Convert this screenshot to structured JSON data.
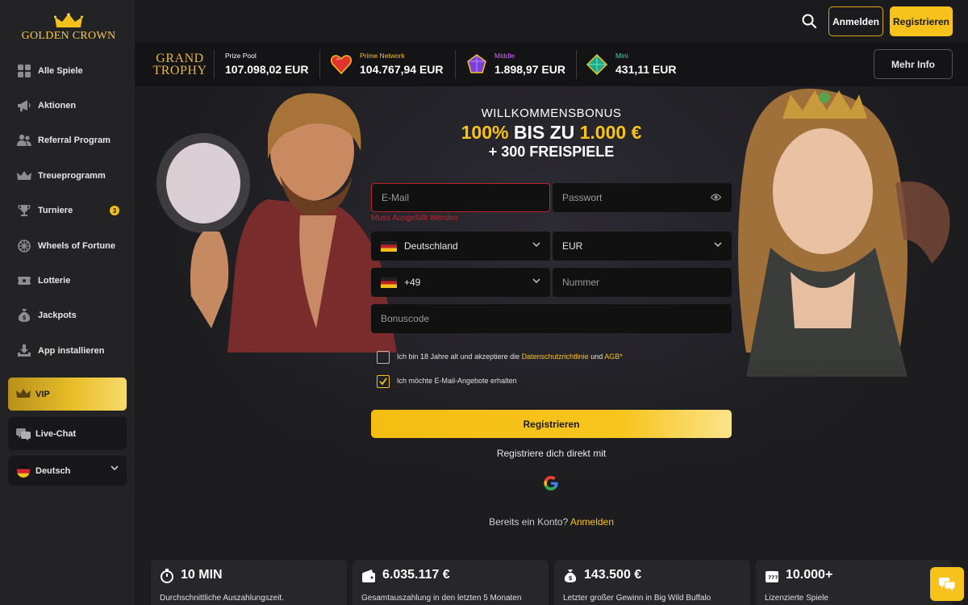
{
  "brand": {
    "name": "GOLDEN CROWN",
    "accent": "#f6c21b"
  },
  "sidebar": {
    "items": [
      {
        "label": "Alle Spiele",
        "icon": "grid-icon"
      },
      {
        "label": "Aktionen",
        "icon": "megaphone-icon"
      },
      {
        "label": "Referral Program",
        "icon": "users-icon"
      },
      {
        "label": "Treueprogramm",
        "icon": "crown-icon"
      },
      {
        "label": "Turniere",
        "icon": "trophy-icon",
        "badge": "3"
      },
      {
        "label": "Wheels of Fortune",
        "icon": "wheel-icon"
      },
      {
        "label": "Lotterie",
        "icon": "ticket-icon"
      },
      {
        "label": "Jackpots",
        "icon": "money-bag-icon"
      },
      {
        "label": "App installieren",
        "icon": "download-icon"
      }
    ],
    "vip_label": "VIP",
    "livechat_label": "Live-Chat",
    "language": "Deutsch"
  },
  "header": {
    "login_label": "Anmelden",
    "register_label": "Registrieren"
  },
  "jackpot": {
    "logo_line1": "GRAND",
    "logo_line2": "TROPHY",
    "tiers": [
      {
        "name": "Prize Pool",
        "value": "107.098,02 EUR",
        "color": "#ffffff"
      },
      {
        "name": "Prime Network",
        "value": "104.767,94 EUR",
        "color": "#f6c21b"
      },
      {
        "name": "Middle",
        "value": "1.898,97 EUR",
        "color": "#d06bf2"
      },
      {
        "name": "Mini",
        "value": "431,11 EUR",
        "color": "#42d6a3"
      }
    ],
    "more_info_label": "Mehr Info"
  },
  "bonus": {
    "title": "WILLKOMMENSBONUS",
    "percent": "100%",
    "upto": "BIS ZU",
    "amount": "1.000 €",
    "spins": "+ 300 FREISPIELE"
  },
  "form": {
    "email_placeholder": "E-Mail",
    "email_error": "Muss Ausgefüllt Werden",
    "password_placeholder": "Passwort",
    "country": "Deutschland",
    "currency": "EUR",
    "phone_code": "+49",
    "phone_placeholder": "Nummer",
    "bonus_placeholder": "Bonuscode",
    "terms_prefix": "Ich bin 18 Jahre alt und akzeptiere die",
    "terms_link": "Datenschutzrichtlinie",
    "terms_and": "und",
    "agb_link": "AGB",
    "terms_required": "*",
    "terms_checked": false,
    "email_offers_label": "Ich möchte E-Mail-Angebote erhalten",
    "email_offers_checked": true,
    "submit_label": "Registrieren",
    "social_label": "Registriere dich direkt mit",
    "have_account": "Bereits ein Konto?",
    "login_link": "Anmelden"
  },
  "stats": [
    {
      "value": "10 MIN",
      "label": "Durchschnittliche Auszahlungszeit.",
      "icon": "stopwatch-icon"
    },
    {
      "value": "6.035.117 €",
      "label": "Gesamtauszahlung in den letzten 5 Monaten",
      "icon": "wallet-icon"
    },
    {
      "value": "143.500 €",
      "label": "Letzter großer Gewinn in Big Wild Buffalo",
      "icon": "money-bag-icon"
    },
    {
      "value": "10.000+",
      "label": "Lizenzierte Spiele",
      "icon": "slot-machine-icon"
    }
  ]
}
